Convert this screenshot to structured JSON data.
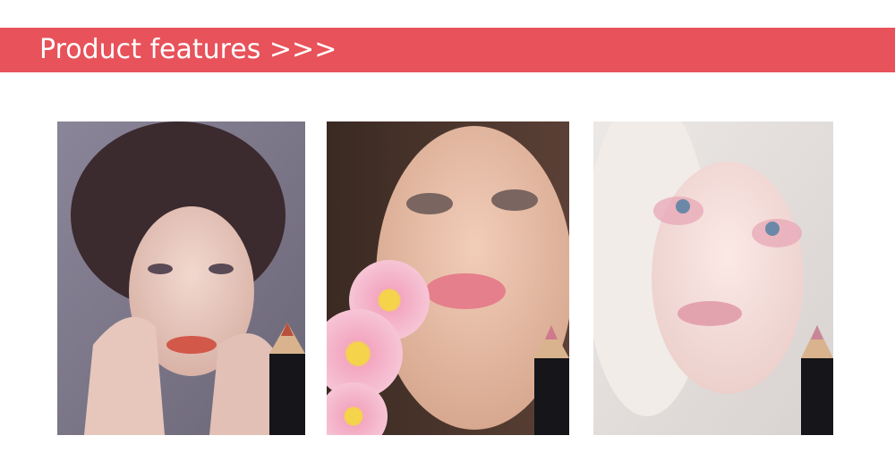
{
  "header": {
    "title": "Product features >>>",
    "accent_color": "#e8525a"
  },
  "gallery": {
    "items": [
      {
        "subject": "model-portrait-dark-bob-hair",
        "pencil_tip_color": "#b8503e",
        "lip_color": "#d2584a"
      },
      {
        "subject": "model-portrait-pink-flowers",
        "pencil_tip_color": "#d0788e",
        "lip_color": "#e57f8c"
      },
      {
        "subject": "model-portrait-platinum-hair",
        "pencil_tip_color": "#c8869a",
        "lip_color": "#e3a3ae"
      }
    ]
  }
}
